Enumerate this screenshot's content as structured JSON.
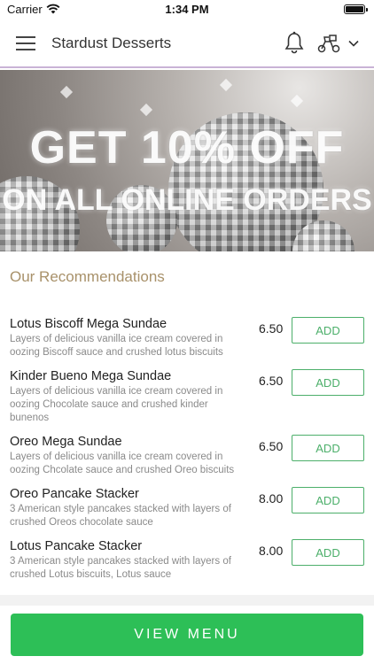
{
  "status_bar": {
    "carrier": "Carrier",
    "time": "1:34 PM"
  },
  "header": {
    "title": "Stardust Desserts"
  },
  "banner": {
    "line1": "GET 10% OFF",
    "line2": "ON ALL ONLINE ORDERS"
  },
  "recommendations": {
    "title": "Our Recommendations",
    "add_label": "ADD",
    "items": [
      {
        "name": "Lotus Biscoff Mega Sundae",
        "description": "Layers of delicious vanilla ice cream covered in oozing Biscoff sauce and crushed lotus biscuits",
        "price": "6.50"
      },
      {
        "name": "Kinder Bueno Mega Sundae",
        "description": "Layers of delicious vanilla ice cream covered in oozing Chocolate sauce and crushed kinder bunenos",
        "price": "6.50"
      },
      {
        "name": "Oreo Mega Sundae",
        "description": "Layers of delicious vanilla ice cream covered in oozing Chcolate sauce and crushed Oreo biscuits",
        "price": "6.50"
      },
      {
        "name": "Oreo Pancake Stacker",
        "description": "3 American style pancakes stacked with layers of crushed Oreos chocolate sauce",
        "price": "8.00"
      },
      {
        "name": "Lotus Pancake Stacker",
        "description": "3 American style pancakes stacked with layers of crushed Lotus biscuits, Lotus sauce",
        "price": "8.00"
      }
    ]
  },
  "view_menu_label": "VIEW MENU",
  "colors": {
    "accent": "#2dbf57",
    "add_border": "#4caf6a",
    "section_title": "#a8916a",
    "header_underline": "#c9b3d6"
  },
  "icons": [
    "menu-icon",
    "bell-icon",
    "scooter-icon",
    "chevron-down-icon",
    "wifi-icon",
    "battery-icon"
  ]
}
